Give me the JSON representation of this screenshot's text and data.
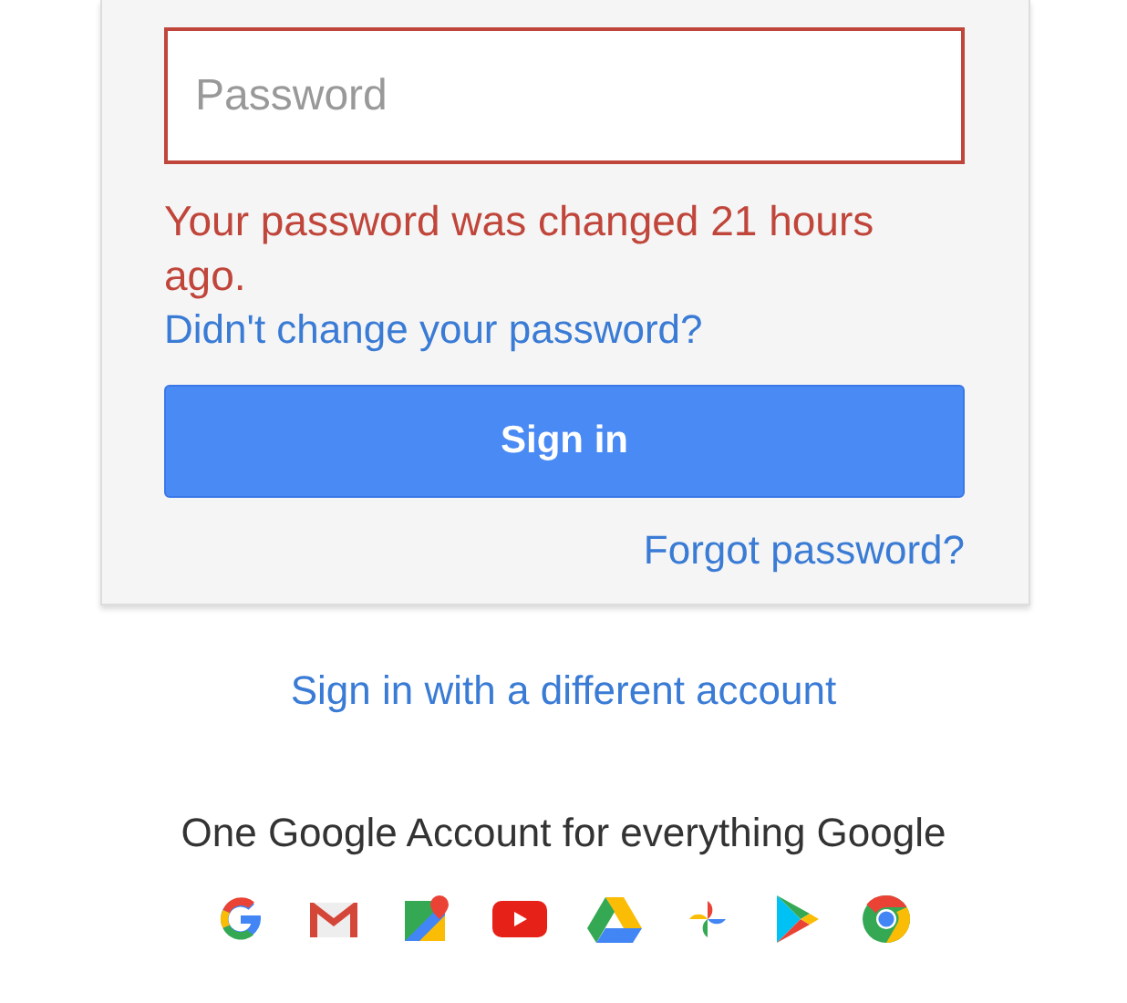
{
  "password_field": {
    "placeholder": "Password",
    "error": true
  },
  "error_message": "Your password was changed 21 hours ago.",
  "recovery_link": "Didn't change your password?",
  "sign_in_button": "Sign in",
  "forgot_link": "Forgot password?",
  "different_account_link": "Sign in with a different account",
  "tagline": "One Google Account for everything Google",
  "app_icons": [
    {
      "kind": "google"
    },
    {
      "kind": "gmail"
    },
    {
      "kind": "maps"
    },
    {
      "kind": "youtube"
    },
    {
      "kind": "drive"
    },
    {
      "kind": "photos"
    },
    {
      "kind": "play"
    },
    {
      "kind": "chrome"
    }
  ]
}
